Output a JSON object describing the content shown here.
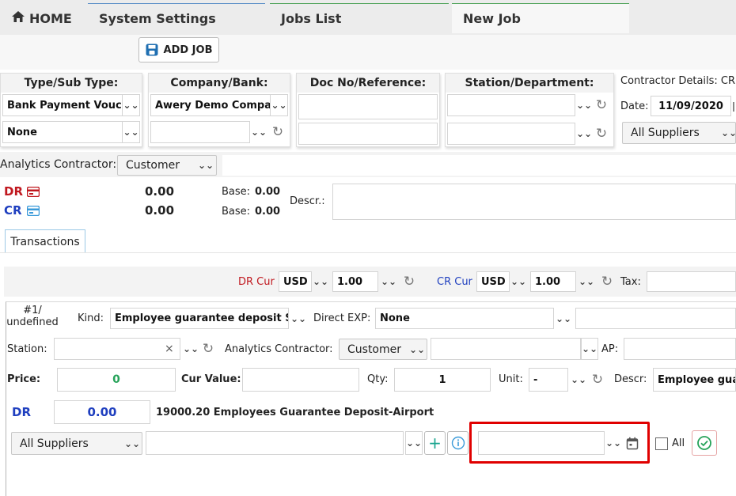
{
  "tabs": {
    "home": "HOME",
    "system_settings": "System Settings",
    "jobs_list": "Jobs List",
    "new_job": "New Job"
  },
  "toolbar": {
    "add_job": "ADD JOB"
  },
  "header": {
    "type_label": "Type/Sub Type:",
    "type_value": "Bank Payment Vouch",
    "subtype_value": "None",
    "company_label": "Company/Bank:",
    "company_value": "Awery Demo Compan",
    "docno_label": "Doc No/Reference:",
    "station_label": "Station/Department:",
    "contractor_details_label": "Contractor Details: CR",
    "date_label": "Date:",
    "date_value": "11/09/2020",
    "suppliers_value": "All Suppliers"
  },
  "analytics": {
    "label": "Analytics Contractor:",
    "value": "Customer"
  },
  "totals": {
    "dr_label": "DR",
    "cr_label": "CR",
    "dr_amount": "0.00",
    "cr_amount": "0.00",
    "base_label": "Base:",
    "dr_base": "0.00",
    "cr_base": "0.00",
    "descr_label": "Descr.:"
  },
  "transactions_tab": "Transactions",
  "currency": {
    "dr_cur_label": "DR Cur",
    "dr_cur": "USD",
    "dr_rate": "1.00",
    "cr_cur_label": "CR Cur",
    "cr_cur": "USD",
    "cr_rate": "1.00",
    "tax_label": "Tax:"
  },
  "line": {
    "number_line1": "#1/",
    "number_line2": "undefined",
    "kind_label": "Kind:",
    "kind_value": "Employee guarantee deposit Sha",
    "direct_exp_label": "Direct EXP:",
    "direct_exp_value": "None",
    "station_label": "Station:",
    "analytics_label": "Analytics Contractor:",
    "analytics_value": "Customer",
    "ap_label": "AP:",
    "price_label": "Price:",
    "price_value": "0",
    "cur_value_label": "Cur Value:",
    "qty_label": "Qty:",
    "qty_value": "1",
    "unit_label": "Unit:",
    "unit_value": "-",
    "descr_label": "Descr:",
    "descr_value": "Employee guar",
    "dr_label": "DR",
    "dr_value": "0.00",
    "account_text": "19000.20 Employees Guarantee Deposit-Airport",
    "suppliers_value": "All Suppliers",
    "all_label": "All"
  },
  "colors": {
    "dr_red": "#c0181f",
    "cr_blue": "#1f3fbf",
    "highlight_red": "#e00000",
    "green_ok": "#27a35a",
    "info_blue": "#3a9ad9",
    "plus_teal": "#1aa58f"
  }
}
